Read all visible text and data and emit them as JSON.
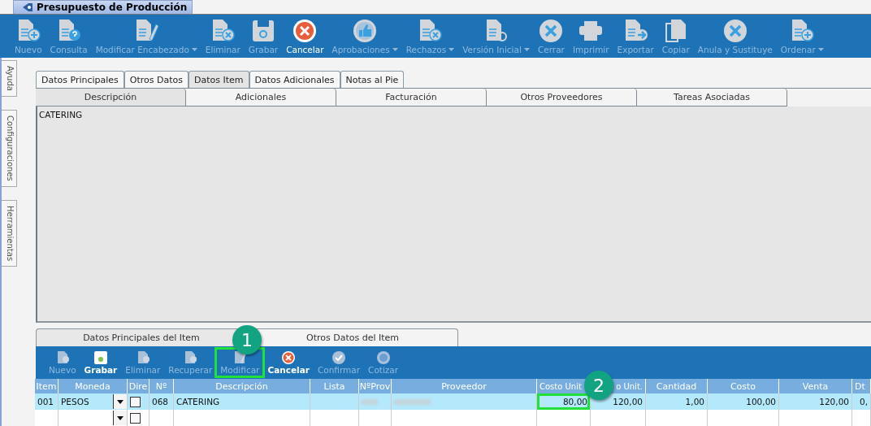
{
  "window": {
    "title": "Presupuesto de Producción"
  },
  "toolbar": [
    {
      "label": "Nuevo",
      "enabled": false,
      "dropdown": false
    },
    {
      "label": "Consulta",
      "enabled": false,
      "dropdown": false
    },
    {
      "label": "Modificar Encabezado",
      "enabled": false,
      "dropdown": true
    },
    {
      "label": "Eliminar",
      "enabled": false,
      "dropdown": false
    },
    {
      "label": "Grabar",
      "enabled": false,
      "dropdown": false
    },
    {
      "label": "Cancelar",
      "enabled": true,
      "dropdown": false
    },
    {
      "label": "Aprobaciones",
      "enabled": false,
      "dropdown": true
    },
    {
      "label": "Rechazos",
      "enabled": false,
      "dropdown": true
    },
    {
      "label": "Versión Inicial",
      "enabled": false,
      "dropdown": true
    },
    {
      "label": "Cerrar",
      "enabled": false,
      "dropdown": false
    },
    {
      "label": "Imprimir",
      "enabled": false,
      "dropdown": false
    },
    {
      "label": "Exportar",
      "enabled": false,
      "dropdown": false
    },
    {
      "label": "Copiar",
      "enabled": false,
      "dropdown": false
    },
    {
      "label": "Anula y Sustituye",
      "enabled": false,
      "dropdown": false
    },
    {
      "label": "Ordenar",
      "enabled": false,
      "dropdown": true
    }
  ],
  "side_tabs": [
    "Ayuda",
    "Configuraciones",
    "Herramientas"
  ],
  "tabs": [
    {
      "label": "Datos Principales",
      "selected": false
    },
    {
      "label": "Otros Datos",
      "selected": false
    },
    {
      "label": "Datos Item",
      "selected": true
    },
    {
      "label": "Datos Adicionales",
      "selected": false
    },
    {
      "label": "Notas al Pie",
      "selected": false
    }
  ],
  "sub_tabs": [
    {
      "label": "Descripción",
      "selected": true
    },
    {
      "label": "Adicionales",
      "selected": false
    },
    {
      "label": "Facturación",
      "selected": false
    },
    {
      "label": "Otros Proveedores",
      "selected": false
    },
    {
      "label": "Tareas Asociadas",
      "selected": false
    }
  ],
  "description_text": "CATERING",
  "item_tabs": [
    {
      "label": "Datos Principales del Item",
      "selected": true
    },
    {
      "label": "Otros Datos del Item",
      "selected": false
    }
  ],
  "item_toolbar": [
    {
      "label": "Nuevo",
      "enabled": false,
      "highlighted": false
    },
    {
      "label": "Grabar",
      "enabled": true,
      "highlighted": false
    },
    {
      "label": "Eliminar",
      "enabled": false,
      "highlighted": false
    },
    {
      "label": "Recuperar",
      "enabled": false,
      "highlighted": false
    },
    {
      "label": "Modificar",
      "enabled": false,
      "highlighted": true
    },
    {
      "label": "Cancelar",
      "enabled": true,
      "highlighted": false
    },
    {
      "label": "Confirmar",
      "enabled": false,
      "highlighted": false
    },
    {
      "label": "Cotizar",
      "enabled": false,
      "highlighted": false
    }
  ],
  "table": {
    "columns": [
      "Item",
      "Moneda",
      "Dire",
      "Nº",
      "Descripción",
      "Lista",
      "NºProv",
      "Proveedor",
      "Costo Unit",
      "o Unit.",
      "Cantidad",
      "Costo",
      "Venta",
      "Dt"
    ],
    "rows": [
      {
        "selected": true,
        "cells": [
          {
            "kind": "text",
            "text": "001"
          },
          {
            "kind": "select",
            "text": "PESOS"
          },
          {
            "kind": "checkbox",
            "checked": false
          },
          {
            "kind": "text",
            "text": "068"
          },
          {
            "kind": "text",
            "text": "CATERING"
          },
          {
            "kind": "empty"
          },
          {
            "kind": "blurred"
          },
          {
            "kind": "blurred"
          },
          {
            "kind": "text",
            "text": "80,00",
            "highlighted": true
          },
          {
            "kind": "text",
            "text": "120,00"
          },
          {
            "kind": "text",
            "text": "1,00"
          },
          {
            "kind": "text",
            "text": "100,00"
          },
          {
            "kind": "text",
            "text": "120,00"
          },
          {
            "kind": "text",
            "text": "0,"
          }
        ]
      },
      {
        "selected": false,
        "cells": [
          {
            "kind": "empty"
          },
          {
            "kind": "select"
          },
          {
            "kind": "checkbox",
            "checked": false
          },
          {
            "kind": "empty"
          },
          {
            "kind": "empty"
          },
          {
            "kind": "empty"
          },
          {
            "kind": "empty"
          },
          {
            "kind": "empty"
          },
          {
            "kind": "empty"
          },
          {
            "kind": "empty"
          },
          {
            "kind": "empty"
          },
          {
            "kind": "empty"
          },
          {
            "kind": "empty"
          },
          {
            "kind": "empty"
          }
        ]
      }
    ]
  },
  "callouts": [
    "1",
    "2"
  ]
}
